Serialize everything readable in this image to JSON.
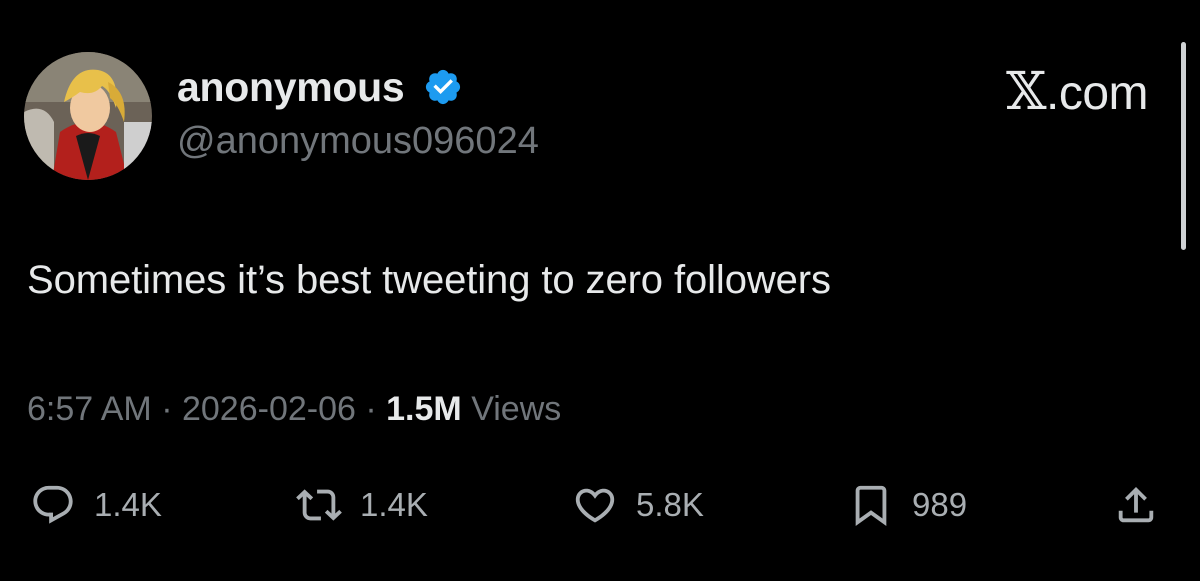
{
  "author": {
    "display_name": "anonymous",
    "handle": "@anonymous096024",
    "verified": true
  },
  "brand": {
    "mark": "𝕏",
    "text": ".com"
  },
  "tweet": {
    "text": "Sometimes it’s best tweeting to zero followers",
    "time": "6:57 AM",
    "date": "2026-02-06",
    "views_count": "1.5M",
    "views_label": "Views"
  },
  "actions": {
    "replies": "1.4K",
    "reposts": "1.4K",
    "likes": "5.8K",
    "bookmarks": "989"
  },
  "colors": {
    "background": "#000000",
    "text_primary": "#e7e9ea",
    "text_secondary": "#71767b",
    "verified_badge": "#1d9bf0"
  },
  "icons": [
    "reply-icon",
    "repost-icon",
    "like-icon",
    "bookmark-icon",
    "share-icon",
    "verified-badge-icon"
  ]
}
